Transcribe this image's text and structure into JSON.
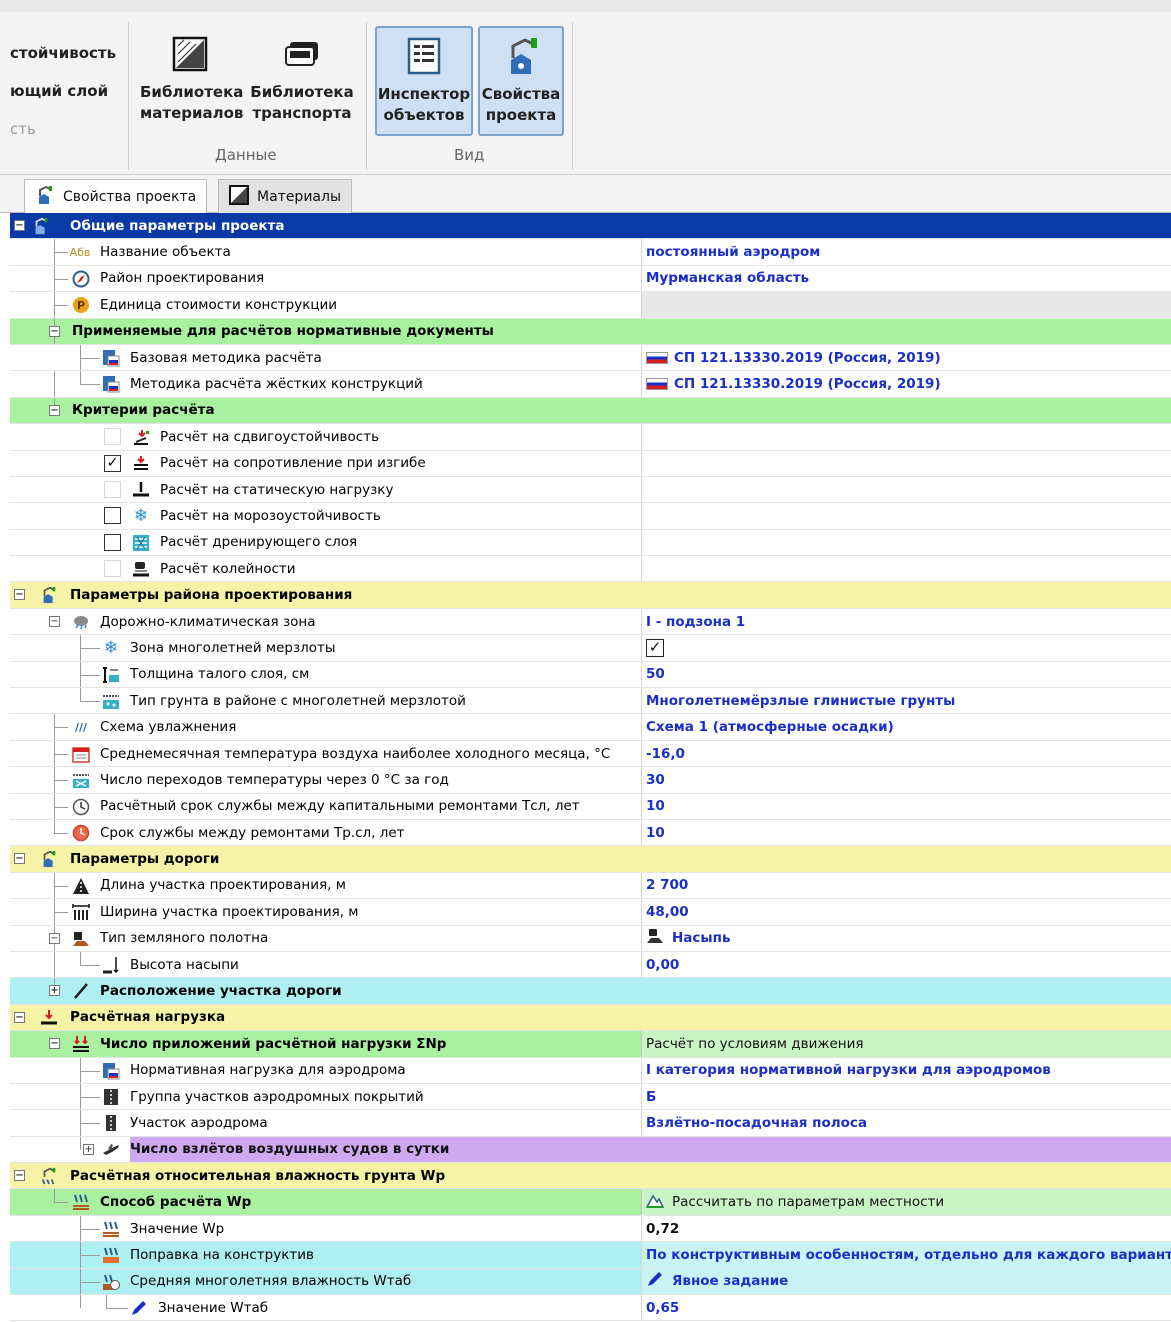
{
  "toolbar": {
    "left_items": [
      "стойчивость",
      "ющий слой",
      "сть"
    ],
    "btn_materials": [
      "Библиотека",
      "материалов"
    ],
    "btn_transport": [
      "Библиотека",
      "транспорта"
    ],
    "btn_inspector": [
      "Инспектор",
      "объектов"
    ],
    "btn_props": [
      "Свойства",
      "проекта"
    ],
    "group_data": "Данные",
    "group_view": "Вид"
  },
  "tabs": [
    "Свойства проекта",
    "Материалы"
  ],
  "rows": {
    "general": "Общие параметры проекта",
    "object_name": "Название объекта",
    "object_name_val": "постоянный аэродром",
    "region": "Район проектирования",
    "region_val": "Мурманская область",
    "cost_unit": "Единица стоимости конструкции",
    "norm_docs": "Применяемые для расчётов нормативные документы",
    "base_method": "Базовая методика расчёта",
    "base_method_val": "СП 121.13330.2019 (Россия, 2019)",
    "rigid_method": "Методика расчёта жёстких конструкций",
    "rigid_method_val": "СП 121.13330.2019 (Россия, 2019)",
    "criteria": "Критерии расчёта",
    "crit1": "Расчёт на сдвигоустойчивость",
    "crit2": "Расчёт на сопротивление при изгибе",
    "crit3": "Расчёт на статическую нагрузку",
    "crit4": "Расчёт на морозоустойчивость",
    "crit5": "Расчёт дренирующего слоя",
    "crit6": "Расчёт колейности",
    "region_params": "Параметры района проектирования",
    "climate_zone": "Дорожно-климатическая зона",
    "climate_zone_val": "I - подзона 1",
    "permafrost": "Зона многолетней мерзлоты",
    "thaw": "Толщина талого слоя, см",
    "thaw_val": "50",
    "soil_type": "Тип грунта в районе с многолетней мерзлотой",
    "soil_type_val": "Многолетнемёрзлые глинистые грунты",
    "moist_scheme": "Схема увлажнения",
    "moist_scheme_val": "Схема 1 (атмосферные осадки)",
    "temp": "Среднемесячная температура воздуха наиболее холодного месяца, °С",
    "temp_val": "-16,0",
    "transitions": "Число переходов температуры через 0 °С за год",
    "transitions_val": "30",
    "service_life": "Расчётный срок службы между капитальными ремонтами Тсл, лет",
    "service_life_val": "10",
    "repair_life": "Срок службы между ремонтами Тр.сл, лет",
    "repair_life_val": "10",
    "road_params": "Параметры дороги",
    "length": "Длина участка проектирования, м",
    "length_val": "2 700",
    "width": "Ширина участка проектирования, м",
    "width_val": "48,00",
    "subgrade": "Тип земляного полотна",
    "subgrade_val": "Насыпь",
    "embank_h": "Высота насыпи",
    "embank_h_val": "0,00",
    "location": "Расположение участка дороги",
    "load": "Расчётная нагрузка",
    "apps": "Число приложений расчётной нагрузки ΣNp",
    "apps_val": "Расчёт по условиям движения",
    "norm_load": "Нормативная нагрузка для аэродрома",
    "norm_load_val": "I категория нормативной нагрузки для аэродромов",
    "group": "Группа участков аэродромных покрытий",
    "group_val": "Б",
    "section": "Участок аэродрома",
    "section_val": "Взлётно-посадочная полоса",
    "takeoffs": "Число взлётов воздушных судов в сутки",
    "humidity": "Расчётная относительная влажность грунта Wp",
    "method_wp": "Способ расчёта Wp",
    "method_wp_val": "Рассчитать по параметрам местности",
    "wp_value": "Значение Wp",
    "wp_value_val": "0,72",
    "correction": "Поправка на конструктив",
    "correction_val": "По конструктивным особенностям, отдельно для каждого варианта",
    "avg_moist": "Средняя многолетняя влажность Wтаб",
    "avg_moist_val": "Явное задание",
    "wtab": "Значение Wтаб",
    "wtab_val": "0,65"
  },
  "colors": {
    "section_blue": "#0a3aa6",
    "section_green": "#a9f0a1",
    "section_yellow": "#f6f2a6",
    "section_cyan": "#aef0f2",
    "purple_val": "#cfa9f0",
    "value_text": "#1a2fc8"
  }
}
